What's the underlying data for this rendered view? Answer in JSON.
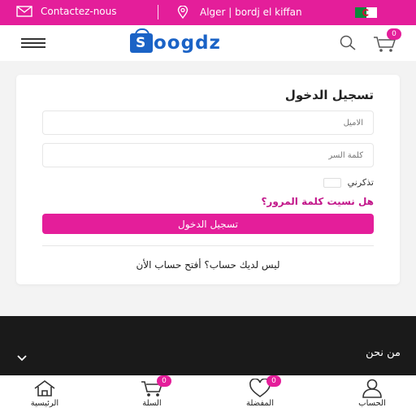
{
  "topbar": {
    "contact_label": "Contactez-nous",
    "location_label": "Alger | bordj el kiffan",
    "mail_icon": "mail-icon",
    "location_icon": "map-pin-icon"
  },
  "header": {
    "logo_text": "oogdz",
    "logo_letter": "S",
    "cart_count": "0"
  },
  "login": {
    "title": "تسجيل الدخول",
    "email_placeholder": "الاميل",
    "password_placeholder": "كلمة السر",
    "remember_label": "تذكرني",
    "forgot_label": "هل نسيت كلمة المرور؟",
    "submit_label": "تسجيل الدخول",
    "register_label": "ليس لديك حساب؟ أفتح حساب الأن"
  },
  "footer": {
    "about_label": "من نحن"
  },
  "bottom_nav": {
    "account_label": "الحساب",
    "favorites_label": "المفضلة",
    "favorites_count": "0",
    "cart_label": "السلة",
    "cart_count": "0",
    "home_label": "الرئيسية"
  },
  "colors": {
    "brand_pink": "#e41e9a",
    "logo_blue": "#1b63c6",
    "footer_dark": "#1a1a1a"
  }
}
